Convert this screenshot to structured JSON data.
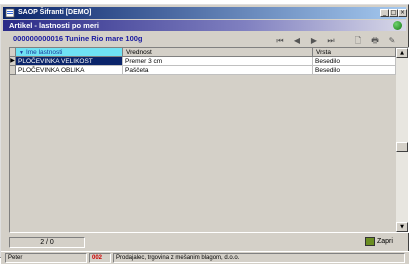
{
  "window": {
    "title": "SAOP Šifranti [DEMO]",
    "controls": {
      "minimize": "_",
      "maximize": "□",
      "close": "×"
    }
  },
  "form": {
    "title": "Artikel - lastnosti po meri",
    "globe_icon": "globe-icon"
  },
  "article": {
    "line": "000000000016 Tunine Rio mare 100g"
  },
  "toolbar": {
    "buttons": [
      {
        "name": "first-record-button",
        "glyph": "⏮"
      },
      {
        "name": "prev-record-button",
        "glyph": "◀"
      },
      {
        "name": "next-record-button",
        "glyph": "▶"
      },
      {
        "name": "last-record-button",
        "glyph": "⏭"
      },
      {
        "name": "new-record-button",
        "glyph": "🗋"
      },
      {
        "name": "print-button",
        "glyph": "🖶"
      },
      {
        "name": "settings-button",
        "glyph": "✎"
      }
    ]
  },
  "grid": {
    "columns": [
      "Ime lastnosti",
      "Vrednost",
      "Vrsta"
    ],
    "sort_indicator": "▼",
    "rows": [
      {
        "name": "PLOČEVINKA VELIKOST",
        "value": "Premer 3 cm",
        "type": "Besedilo",
        "selected": true
      },
      {
        "name": "PLOČEVINKA OBLIKA",
        "value": "Paščeta",
        "type": "Besedilo",
        "selected": false
      }
    ],
    "row_pointer": "▶"
  },
  "footer": {
    "record_counter": "2 / 0",
    "close_label": "Zapri"
  },
  "statusbar": {
    "user": "Peter",
    "code": "002",
    "company": "Prodajalec, trgovina z mešanim blagom, d.o.o."
  },
  "colors": {
    "title_active": "#0a246a",
    "sorted_header": "#6fe2f4",
    "selection": "#0a246a",
    "code_red": "#cc0000"
  }
}
